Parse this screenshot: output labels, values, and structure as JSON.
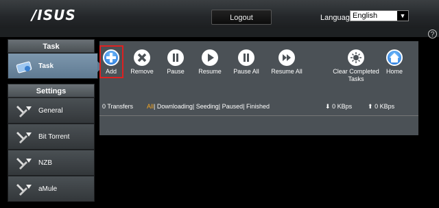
{
  "header": {
    "logo": "/ISUS",
    "logout_label": "Logout",
    "language_label": "Language",
    "language_value": "English"
  },
  "sidebar": {
    "task_header": "Task",
    "task_item": "Task",
    "settings_header": "Settings",
    "items": [
      {
        "label": "General",
        "icon": "tools-icon"
      },
      {
        "label": "Bit Torrent",
        "icon": "tools-icon"
      },
      {
        "label": "NZB",
        "icon": "tools-icon"
      },
      {
        "label": "aMule",
        "icon": "tools-icon"
      }
    ]
  },
  "toolbar": {
    "add": "Add",
    "remove": "Remove",
    "pause": "Pause",
    "resume": "Resume",
    "pause_all": "Pause All",
    "resume_all": "Resume All",
    "clear_completed": "Clear Completed Tasks",
    "home": "Home"
  },
  "status": {
    "transfers": "0 Transfers",
    "filter_all": "All",
    "filter_rest": "| Downloading| Seeding| Paused| Finished",
    "download_speed": "0 KBps",
    "upload_speed": "0 KBps"
  },
  "colors": {
    "accent_orange": "#f5a623",
    "highlight_red": "#e02020",
    "panel_bg": "#4b5156"
  }
}
